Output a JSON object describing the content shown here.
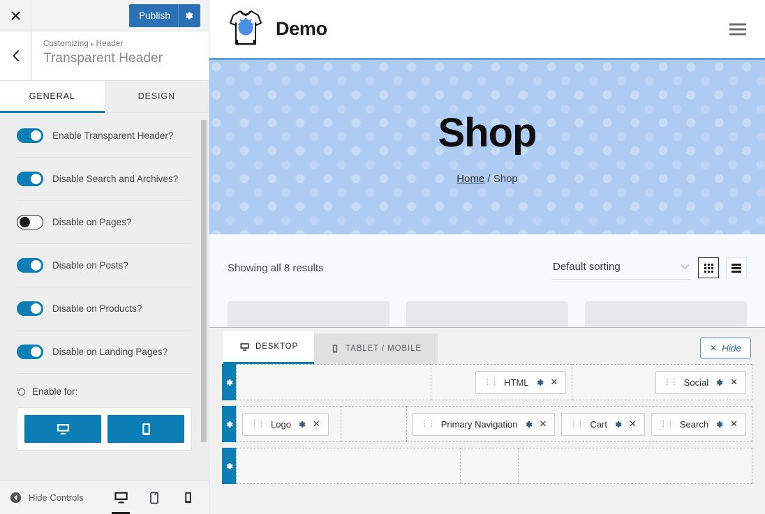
{
  "sidebar": {
    "close_icon": "close-icon",
    "publish": {
      "label": "Publish",
      "gear_icon": "gear-icon",
      "color": "#2a72b5"
    },
    "back_icon": "chevron-left-icon",
    "breadcrumb": {
      "root": "Customizing",
      "separator": "▸",
      "current": "Header"
    },
    "panel_title": "Transparent Header",
    "tabs": [
      {
        "label": "GENERAL",
        "active": true
      },
      {
        "label": "DESIGN",
        "active": false
      }
    ],
    "options": [
      {
        "label": "Enable Transparent Header?",
        "on": true
      },
      {
        "label": "Disable Search and Archives?",
        "on": true
      },
      {
        "label": "Disable on Pages?",
        "on": false
      },
      {
        "label": "Disable on Posts?",
        "on": true
      },
      {
        "label": "Disable on Products?",
        "on": true
      },
      {
        "label": "Disable on Landing Pages?",
        "on": true
      }
    ],
    "enable_for": {
      "label": "Enable for:",
      "reset_icon": "reset-icon",
      "buttons": [
        {
          "icon": "desktop-icon",
          "active": true
        },
        {
          "icon": "mobile-icon",
          "active": true
        }
      ]
    },
    "footer": {
      "hide_controls_label": "Hide Controls",
      "hide_controls_icon": "arrow-left-circle-icon",
      "devices": [
        {
          "icon": "desktop-icon",
          "active": true
        },
        {
          "icon": "tablet-icon",
          "active": false
        },
        {
          "icon": "mobile-icon",
          "active": false
        }
      ]
    }
  },
  "preview": {
    "header": {
      "logo_icon": "tshirt-logo-icon",
      "site_title": "Demo",
      "menu_icon": "hamburger-icon"
    },
    "hero": {
      "title": "Shop",
      "breadcrumb_home": "Home",
      "breadcrumb_sep": "/",
      "breadcrumb_current": "Shop",
      "bg_color": "#aecbf2"
    },
    "shop": {
      "results_text": "Showing all 8 results",
      "sort_value": "Default sorting",
      "sort_caret_icon": "chevron-down-icon",
      "grid_view_icon": "grid-view-icon",
      "list_view_icon": "list-view-icon",
      "grid_active": true
    }
  },
  "builder": {
    "tabs": [
      {
        "label": "DESKTOP",
        "icon": "desktop-icon",
        "active": true
      },
      {
        "label": "TABLET / MOBILE",
        "icon": "mobile-icon",
        "active": false
      }
    ],
    "hide_button": {
      "label": "Hide",
      "icon": "close-icon"
    },
    "rows": [
      {
        "handle_icon": "gear-icon",
        "zones": [
          {
            "align": "left",
            "flex": 3.1,
            "items": []
          },
          {
            "align": "right",
            "flex": 2.2,
            "items": [
              {
                "label": "HTML"
              }
            ]
          },
          {
            "align": "right",
            "flex": 2.85,
            "items": [
              {
                "label": "Social"
              }
            ]
          }
        ]
      },
      {
        "handle_icon": "gear-icon",
        "zones": [
          {
            "align": "left",
            "flex": 2.25,
            "items": [
              {
                "label": "Logo"
              }
            ]
          },
          {
            "align": "left",
            "flex": 1.3,
            "items": []
          },
          {
            "align": "right",
            "flex": 4.6,
            "items": [
              {
                "label": "Primary Navigation"
              },
              {
                "label": "Cart"
              },
              {
                "label": "Search"
              }
            ]
          }
        ]
      },
      {
        "handle_icon": "gear-icon",
        "zones": [
          {
            "align": "left",
            "flex": 3.45,
            "items": []
          },
          {
            "align": "left",
            "flex": 0.75,
            "items": []
          },
          {
            "align": "left",
            "flex": 3.6,
            "items": []
          }
        ]
      }
    ],
    "chip_gear_icon": "gear-icon",
    "chip_remove_icon": "close-icon",
    "chip_drag_icon": "drag-handle-icon"
  }
}
